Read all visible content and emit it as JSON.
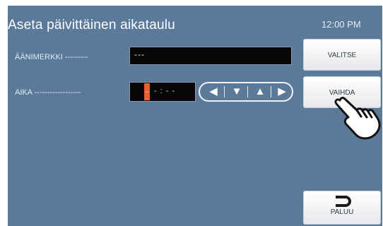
{
  "header": {
    "title": "Aseta päivittäinen aikataulu",
    "time": "12:00 PM"
  },
  "fields": {
    "ringtone": {
      "label": "ÄÄNIMERKKI ---------",
      "value": "---"
    },
    "time": {
      "label": "AIKA ------------------",
      "value": "- : - -"
    }
  },
  "arrows": {
    "left": "◀",
    "down": "▼",
    "up": "▲",
    "right": "▶"
  },
  "buttons": {
    "select": "VALITSE",
    "change": "VAIHDA",
    "back": "PALUU"
  }
}
